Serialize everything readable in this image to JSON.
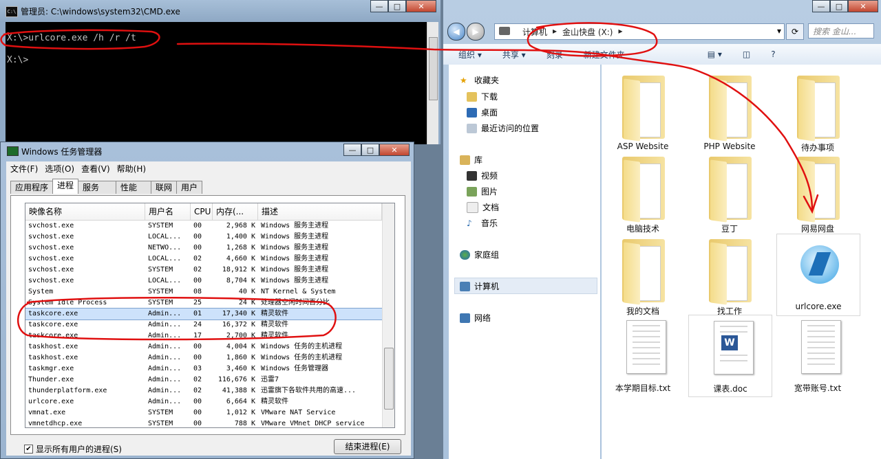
{
  "cmd": {
    "title": "管理员: C:\\windows\\system32\\CMD.exe",
    "icon_text": "C:\\",
    "lines": [
      "X:\\>urlcore.exe /h /r /t",
      "X:\\>"
    ]
  },
  "taskmgr": {
    "title": "Windows 任务管理器",
    "menu": [
      "文件(F)",
      "选项(O)",
      "查看(V)",
      "帮助(H)"
    ],
    "tabs": [
      "应用程序",
      "进程",
      "服务",
      "性能",
      "联网",
      "用户"
    ],
    "active_tab": "进程",
    "columns": [
      "映像名称",
      "用户名",
      "CPU",
      "内存(...",
      "描述"
    ],
    "rows": [
      [
        "svchost.exe",
        "SYSTEM",
        "00",
        "2,968 K",
        "Windows 服务主进程"
      ],
      [
        "svchost.exe",
        "LOCAL...",
        "00",
        "1,400 K",
        "Windows 服务主进程"
      ],
      [
        "svchost.exe",
        "NETWO...",
        "00",
        "1,268 K",
        "Windows 服务主进程"
      ],
      [
        "svchost.exe",
        "LOCAL...",
        "02",
        "4,660 K",
        "Windows 服务主进程"
      ],
      [
        "svchost.exe",
        "SYSTEM",
        "02",
        "18,912 K",
        "Windows 服务主进程"
      ],
      [
        "svchost.exe",
        "LOCAL...",
        "00",
        "8,704 K",
        "Windows 服务主进程"
      ],
      [
        "System",
        "SYSTEM",
        "08",
        "40 K",
        "NT Kernel & System"
      ],
      [
        "System Idle Process",
        "SYSTEM",
        "25",
        "24 K",
        "处理器空闲时间百分比"
      ],
      [
        "taskcore.exe",
        "Admin...",
        "01",
        "17,340 K",
        "精灵软件"
      ],
      [
        "taskcore.exe",
        "Admin...",
        "24",
        "16,372 K",
        "精灵软件"
      ],
      [
        "taskcore.exe",
        "Admin...",
        "17",
        "2,700 K",
        "精灵软件"
      ],
      [
        "taskhost.exe",
        "Admin...",
        "00",
        "4,004 K",
        "Windows 任务的主机进程"
      ],
      [
        "taskhost.exe",
        "Admin...",
        "00",
        "1,860 K",
        "Windows 任务的主机进程"
      ],
      [
        "taskmgr.exe",
        "Admin...",
        "03",
        "3,460 K",
        "Windows 任务管理器"
      ],
      [
        "Thunder.exe",
        "Admin...",
        "02",
        "116,676 K",
        "迅雷7"
      ],
      [
        "thunderplatform.exe",
        "Admin...",
        "02",
        "41,388 K",
        "迅雷旗下各软件共用的高速..."
      ],
      [
        "urlcore.exe",
        "Admin...",
        "00",
        "6,664 K",
        "精灵软件"
      ],
      [
        "vmnat.exe",
        "SYSTEM",
        "00",
        "1,012 K",
        "VMware NAT Service"
      ],
      [
        "vmnetdhcp.exe",
        "SYSTEM",
        "00",
        "788 K",
        "VMware VMnet DHCP service"
      ]
    ],
    "selected_row": 8,
    "show_all_label": "显示所有用户的进程(S)",
    "end_process_label": "结束进程(E)"
  },
  "explorer": {
    "breadcrumb": [
      "计算机",
      "金山快盘 (X:)"
    ],
    "search_placeholder": "搜索 金山...",
    "toolbar": [
      "组织 ▾",
      "共享 ▾",
      "刻录",
      "新建文件夹"
    ],
    "sidebar": {
      "favorites": "收藏夹",
      "fav_items": [
        "下载",
        "桌面",
        "最近访问的位置"
      ],
      "library": "库",
      "lib_items": [
        "视频",
        "图片",
        "文档",
        "音乐"
      ],
      "homegroup": "家庭组",
      "computer": "计算机",
      "network": "网络"
    },
    "files": [
      {
        "name": "ASP Website",
        "kind": "folder"
      },
      {
        "name": "PHP Website",
        "kind": "folder"
      },
      {
        "name": "待办事项",
        "kind": "folder"
      },
      {
        "name": "电脑技术",
        "kind": "folder"
      },
      {
        "name": "豆丁",
        "kind": "folder"
      },
      {
        "name": "网易网盘",
        "kind": "folder"
      },
      {
        "name": "我的文档",
        "kind": "folder"
      },
      {
        "name": "找工作",
        "kind": "folder"
      },
      {
        "name": "urlcore.exe",
        "kind": "exe"
      },
      {
        "name": "本学期目标.txt",
        "kind": "txt"
      },
      {
        "name": "课表.doc",
        "kind": "doc"
      },
      {
        "name": "宽带账号.txt",
        "kind": "txt"
      }
    ]
  },
  "colors": {
    "annotation": "#e01010",
    "selection": "#cde2fb",
    "folder": "#f1d781"
  }
}
